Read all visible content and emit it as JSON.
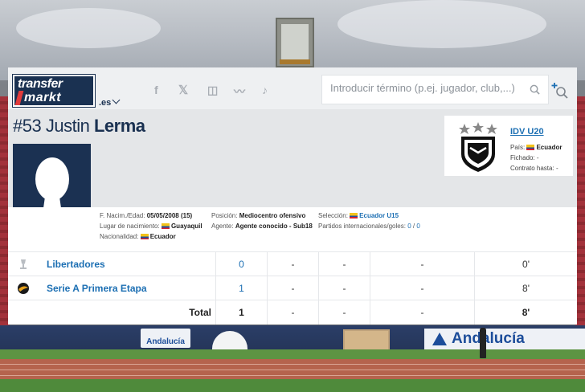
{
  "header": {
    "logo_line1": "transfer",
    "logo_line2": "markt",
    "domain": ".es",
    "social": [
      "f",
      "𝕏",
      "◫",
      "〰",
      "♪"
    ],
    "search_placeholder": "Introducir término (p.ej. jugador, club,...)"
  },
  "player": {
    "number": "#53",
    "first_name": "Justin",
    "last_name": "Lerma"
  },
  "club": {
    "name": "IDV U20",
    "country_label": "País:",
    "country": "Ecuador",
    "signed_label": "Fichado:",
    "signed": "-",
    "contract_label": "Contrato hasta:",
    "contract": "-"
  },
  "info": {
    "birth_label": "F. Nacim./Edad:",
    "birth": "05/05/2008 (15)",
    "birthplace_label": "Lugar de nacimiento:",
    "birthplace": "Guayaquil",
    "nationality_label": "Nacionalidad:",
    "nationality": "Ecuador",
    "position_label": "Posición:",
    "position": "Mediocentro ofensivo",
    "agent_label": "Agente:",
    "agent": "Agente conocido - Sub18",
    "selection_label": "Selección:",
    "selection": "Ecuador U15",
    "caps_label": "Partidos internacionales/goles:",
    "caps": "0",
    "caps_sep": "/",
    "goals": "0"
  },
  "stats": {
    "rows": [
      {
        "competition": "Libertadores",
        "apps": "0",
        "c2": "-",
        "c3": "-",
        "c4": "-",
        "minutes": "0'"
      },
      {
        "competition": "Serie A Primera Etapa",
        "apps": "1",
        "c2": "-",
        "c3": "-",
        "c4": "-",
        "minutes": "8'"
      }
    ],
    "total": {
      "label": "Total",
      "apps": "1",
      "c2": "-",
      "c3": "-",
      "c4": "-",
      "minutes": "8'"
    }
  },
  "colors": {
    "brand_navy": "#1a3151",
    "link_blue": "#1c6fb3"
  }
}
